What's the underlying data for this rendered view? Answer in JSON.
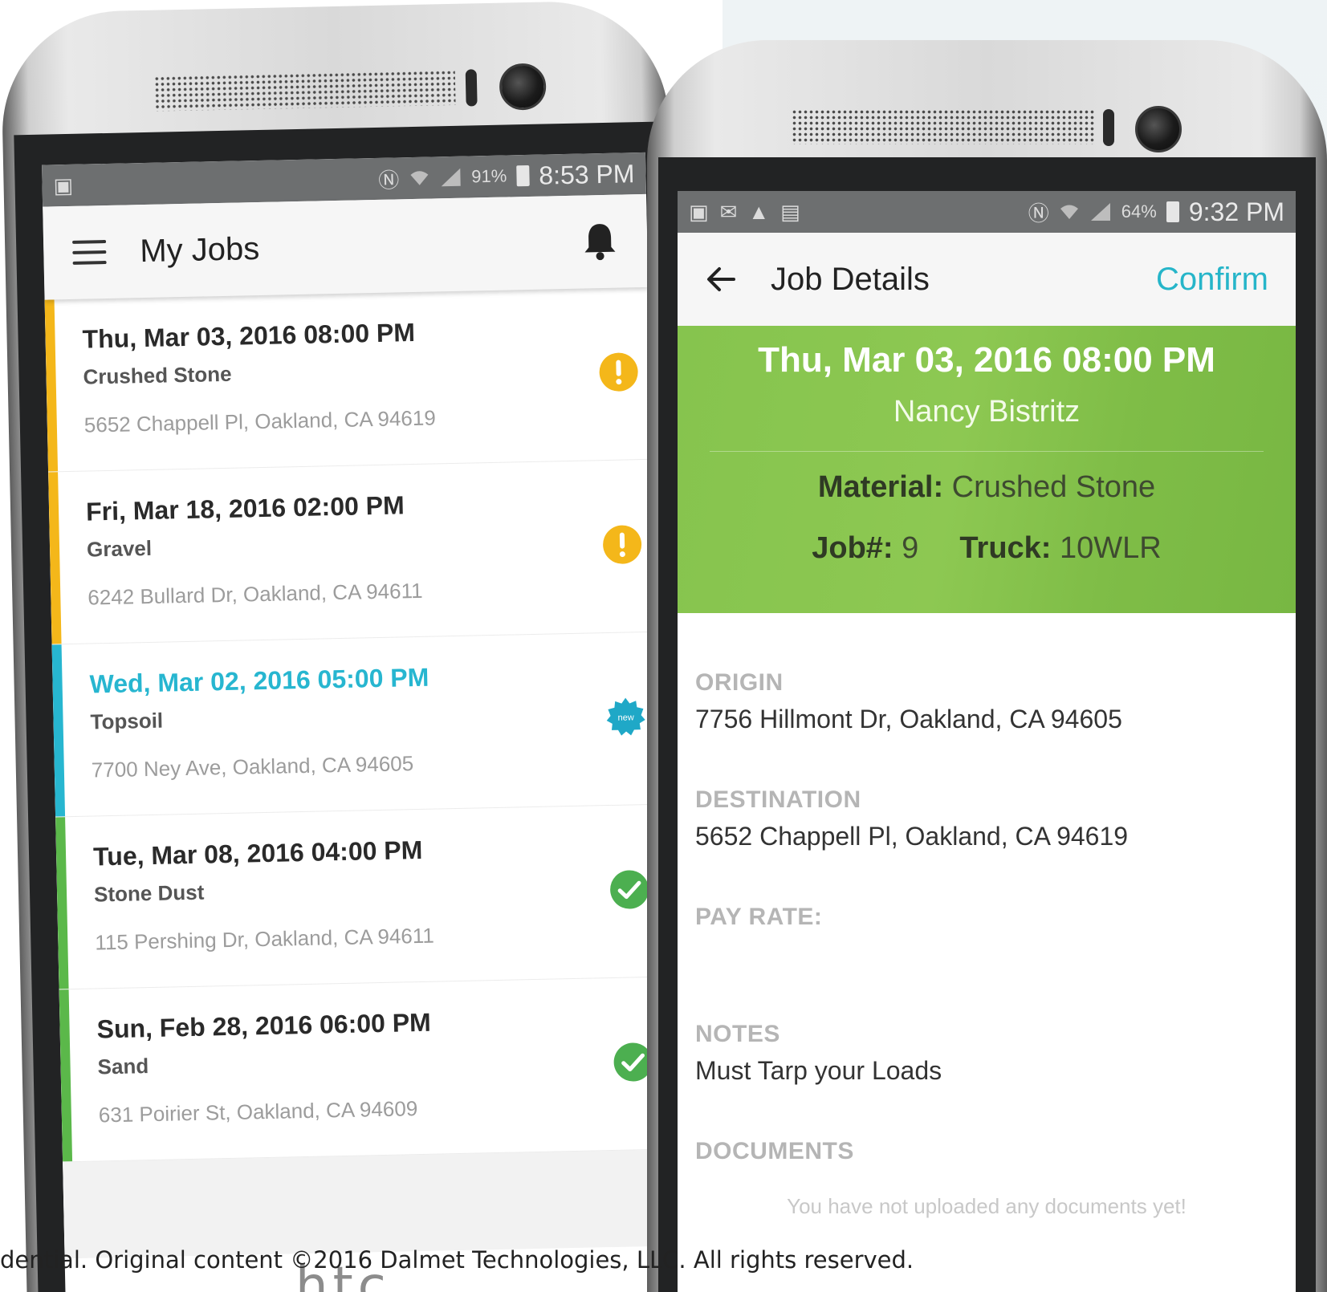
{
  "left_phone": {
    "status_bar": {
      "battery": "91%",
      "time": "8:53 PM"
    },
    "app_bar": {
      "title": "My Jobs"
    },
    "jobs": [
      {
        "date": "Thu, Mar 03, 2016 08:00 PM",
        "material": "Crushed Stone",
        "address": "5652 Chappell Pl, Oakland, CA 94619",
        "status": "warning",
        "bar_color": "#f4b71a",
        "date_color": "#2a2a2a"
      },
      {
        "date": "Fri, Mar 18, 2016 02:00 PM",
        "material": "Gravel",
        "address": "6242 Bullard Dr, Oakland, CA 94611",
        "status": "warning",
        "bar_color": "#f4b71a",
        "date_color": "#2a2a2a"
      },
      {
        "date": "Wed, Mar 02, 2016 05:00 PM",
        "material": "Topsoil",
        "address": "7700 Ney Ave, Oakland, CA 94605",
        "status": "new",
        "badge_text": "new",
        "bar_color": "#27b6d0",
        "date_color": "#27b6d0"
      },
      {
        "date": "Tue, Mar 08, 2016 04:00 PM",
        "material": "Stone Dust",
        "address": "115 Pershing Dr, Oakland, CA 94611",
        "status": "completed",
        "bar_color": "#5bb84a",
        "date_color": "#2a2a2a"
      },
      {
        "date": "Sun, Feb 28, 2016 06:00 PM",
        "material": "Sand",
        "address": "631 Poirier St, Oakland, CA 94609",
        "status": "completed",
        "bar_color": "#5bb84a",
        "date_color": "#2a2a2a"
      }
    ],
    "brand": "htc"
  },
  "right_phone": {
    "status_bar": {
      "battery": "64%",
      "time": "9:32 PM"
    },
    "app_bar": {
      "title": "Job Details",
      "confirm_label": "Confirm"
    },
    "header": {
      "date": "Thu, Mar 03, 2016 08:00 PM",
      "customer": "Nancy Bistritz",
      "material_label": "Material:",
      "material_value": "Crushed Stone",
      "job_label": "Job#:",
      "job_value": "9",
      "truck_label": "Truck:",
      "truck_value": "10WLR"
    },
    "sections": {
      "origin_label": "ORIGIN",
      "origin_value": "7756 Hillmont Dr, Oakland, CA 94605",
      "destination_label": "DESTINATION",
      "destination_value": "5652 Chappell Pl, Oakland, CA 94619",
      "pay_rate_label": "PAY RATE:",
      "notes_label": "NOTES",
      "notes_value": "Must Tarp your Loads",
      "documents_label": "DOCUMENTS",
      "documents_empty": "You have not uploaded any documents yet!"
    }
  },
  "footer": {
    "copyright": "dential. Original content ©2016 Dalmet Technologies, LLC. All rights reserved."
  },
  "colors": {
    "accent": "#26b5c9",
    "header_green": "#86c44e",
    "warning": "#f4b71a",
    "success": "#4caf50"
  }
}
